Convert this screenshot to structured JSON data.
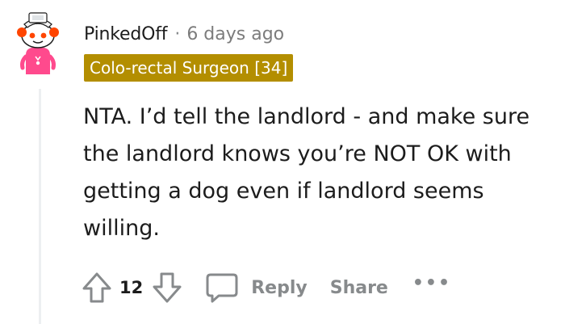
{
  "comment": {
    "username": "PinkedOff",
    "separator": "·",
    "timestamp": "6 days ago",
    "flair": "Colo-rectal Surgeon [34]",
    "body": "NTA. I’d tell the landlord - and make sure the landlord knows you’re NOT OK with getting a dog even if landlord seems willing."
  },
  "actions": {
    "upvote_icon": "arrow-up-icon",
    "score": "12",
    "downvote_icon": "arrow-down-icon",
    "reply_icon": "speech-bubble-icon",
    "reply_label": "Reply",
    "share_label": "Share",
    "more_label": "•••"
  },
  "colors": {
    "flair_bg": "#b38e00",
    "avatar_body": "#ff4a8d",
    "avatar_accent": "#ff4500",
    "muted": "#878a8c"
  }
}
